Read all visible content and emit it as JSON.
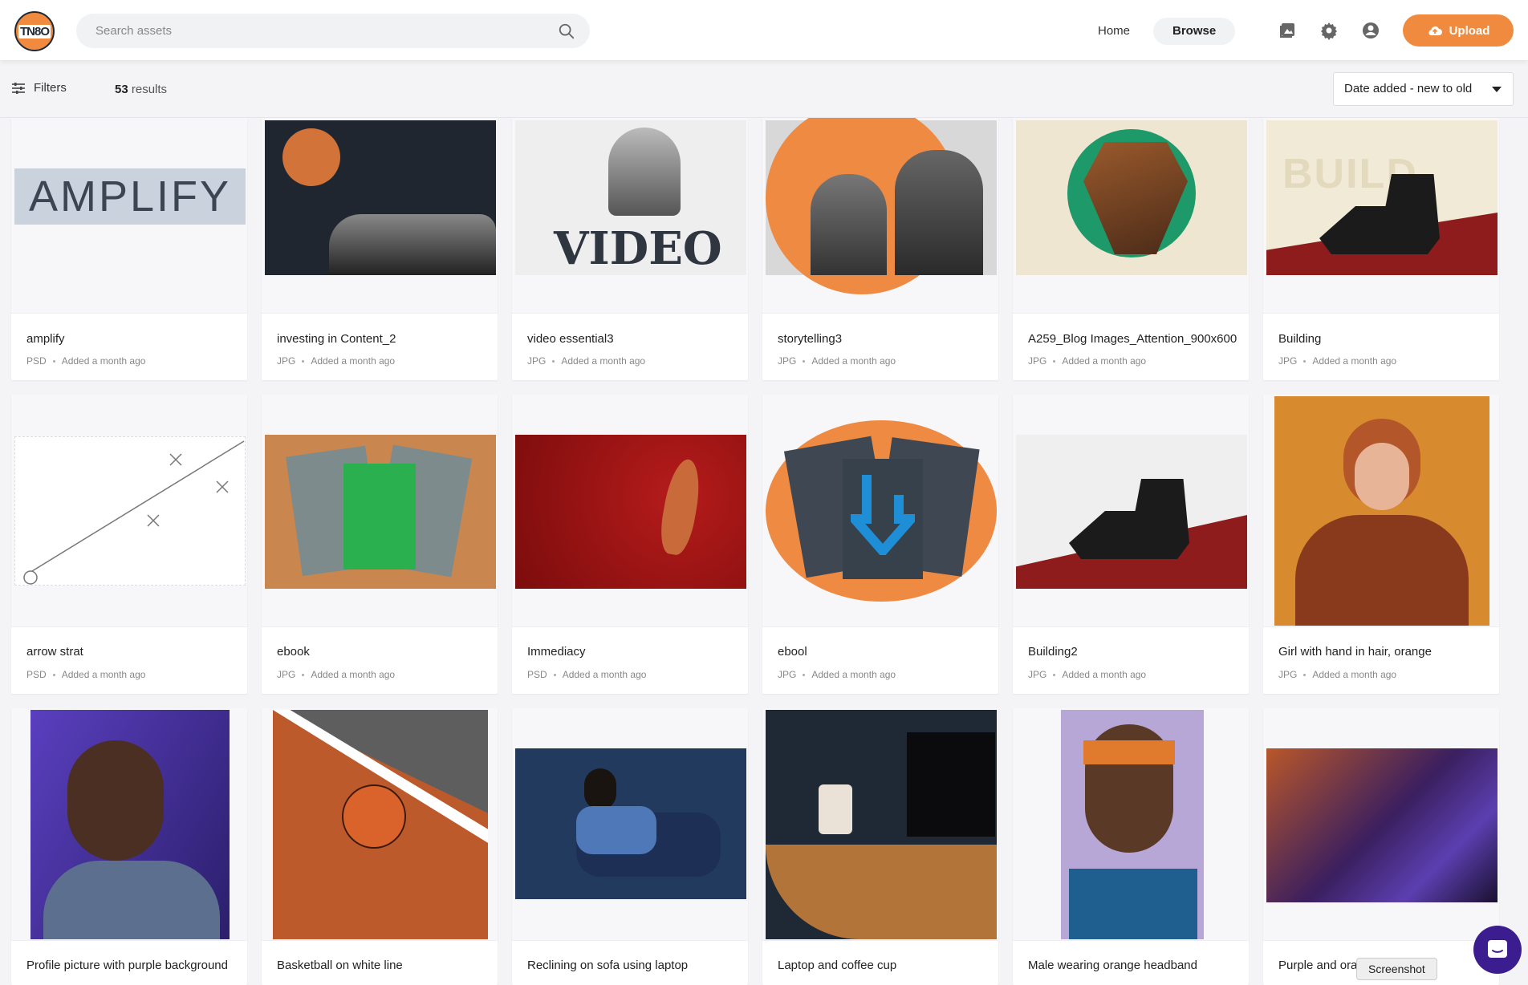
{
  "header": {
    "logo_text": "TN8O",
    "search_placeholder": "Search assets",
    "nav": {
      "home": "Home",
      "browse": "Browse"
    },
    "icons": [
      "images-icon",
      "gear-icon",
      "account-icon"
    ],
    "upload_label": "Upload",
    "accent": "#f08a3e"
  },
  "toolbar": {
    "filters_label": "Filters",
    "results_count": "53",
    "results_label": "results",
    "sort_value": "Date added - new to old"
  },
  "assets": [
    {
      "title": "amplify",
      "type": "PSD",
      "added": "Added a month ago",
      "thumb_text": "AMPLIFY"
    },
    {
      "title": "investing in Content_2",
      "type": "JPG",
      "added": "Added a month ago"
    },
    {
      "title": "video essential3",
      "type": "JPG",
      "added": "Added a month ago",
      "thumb_text": "VIDEO"
    },
    {
      "title": "storytelling3",
      "type": "JPG",
      "added": "Added a month ago"
    },
    {
      "title": "A259_Blog Images_Attention_900x600",
      "type": "JPG",
      "added": "Added a month ago"
    },
    {
      "title": "Building",
      "type": "JPG",
      "added": "Added a month ago",
      "thumb_text": "BUILD"
    },
    {
      "title": "arrow strat",
      "type": "PSD",
      "added": "Added a month ago"
    },
    {
      "title": "ebook",
      "type": "JPG",
      "added": "Added a month ago"
    },
    {
      "title": "Immediacy",
      "type": "PSD",
      "added": "Added a month ago"
    },
    {
      "title": "ebool",
      "type": "JPG",
      "added": "Added a month ago"
    },
    {
      "title": "Building2",
      "type": "JPG",
      "added": "Added a month ago"
    },
    {
      "title": "Girl with hand in hair, orange",
      "type": "JPG",
      "added": "Added a month ago"
    },
    {
      "title": "Profile picture with purple background"
    },
    {
      "title": "Basketball on white line"
    },
    {
      "title": "Reclining on sofa using laptop"
    },
    {
      "title": "Laptop and coffee cup"
    },
    {
      "title": "Male wearing orange headband"
    },
    {
      "title": "Purple and ora"
    }
  ],
  "tooltip": "Screenshot"
}
